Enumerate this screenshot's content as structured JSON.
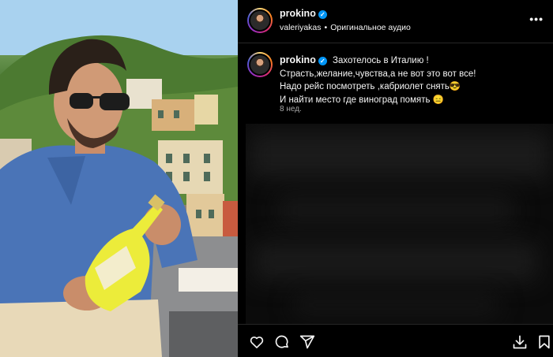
{
  "post": {
    "author": "prokino",
    "subtitle": {
      "user": "valeriyakas",
      "separator": "•",
      "audio": "Оригинальное аудио"
    },
    "more_label": "•••",
    "caption": {
      "author": "prokino",
      "lines": [
        "Захотелось в Италию !",
        "Страсть,желание,чувства,а не вот это вот все!",
        "Надо рейс посмотреть ,кабриолет снять😎",
        "И найти место где виноград помять 😑"
      ],
      "time": "8 нед."
    }
  },
  "actions": {
    "like": "heart-icon",
    "comment": "comment-icon",
    "share": "share-icon",
    "download": "download-icon",
    "save": "bookmark-icon"
  },
  "colors": {
    "background": "#000000",
    "verified": "#0095f6",
    "muted_text": "#a8a8a8"
  }
}
